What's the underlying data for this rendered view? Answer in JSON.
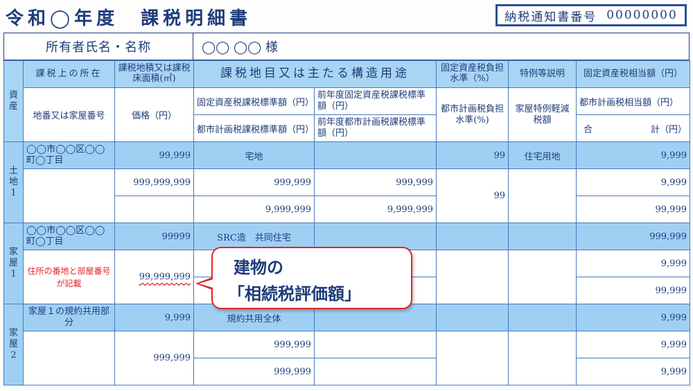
{
  "header": {
    "title": "令和◯年度　課税明細書",
    "notice_label": "納税通知書番号",
    "notice_number": "00000000"
  },
  "owner": {
    "label": "所有者氏名・名称",
    "value": "◯◯ ◯◯ 様"
  },
  "headers": {
    "asset": "資産",
    "location": "課税上の所在",
    "area": "課税地積又は課税床面積(㎡)",
    "purpose": "課税地目又は主たる構造用途",
    "burden": "固定資産税負担水準（%）",
    "special": "特例等説明",
    "tax_equiv": "固定資産税相当額（円）",
    "lot": "地番又は家屋番号",
    "price": "価格（円）",
    "std_fixed": "固定資産税課税標準額（円）",
    "prev_std_fixed": "前年度固定資産税課税標準額（円）",
    "city_burden": "都市計画税負担水準(%)",
    "house_special": "家屋特例軽減税額",
    "city_equiv": "都市計画税相当額（円）",
    "std_city": "都市計画税課税標準額（円）",
    "prev_std_city": "前年度都市計画税課税標準額（円）",
    "total_a": "合",
    "total_b": "計（円）"
  },
  "land1": {
    "group": "土地1",
    "location": "◯◯市◯◯区◯◯町◯丁目",
    "area": "99,999",
    "purpose": "宅地",
    "burden": "99",
    "special": "住宅用地",
    "tax": "9,999",
    "price": "999,999,999",
    "std_fixed": "999,999",
    "prev_std_fixed": "999,999",
    "city_burden": "99",
    "city_tax": "9,999",
    "std_city": "9,999,999",
    "prev_std_city": "9,999,999",
    "total": "99,999"
  },
  "house1": {
    "group": "家屋1",
    "location": "◯◯市◯◯区◯◯町◯丁目",
    "area": "99999",
    "purpose": "SRC造　共同住宅",
    "tax": "999,999",
    "note": "住所の番地と部屋番号が記載",
    "price": "99,999,999",
    "city_tax": "9,999",
    "total": "99,999"
  },
  "house2": {
    "group": "家屋2",
    "location": "家屋１の規約共用部分",
    "area": "9,999",
    "purpose": "規約共用全体",
    "tax": "9,999",
    "price": "999,999",
    "std_fixed": "999,999",
    "std_city": "999,999",
    "city_tax": "9,999",
    "total": "9,999"
  },
  "callout": {
    "line1": "建物の",
    "line2": "「相続税評価額」"
  },
  "colors": {
    "header_blue": "#9fd0f3",
    "ink": "#1e3c7a",
    "accent_red": "#e0262a"
  }
}
